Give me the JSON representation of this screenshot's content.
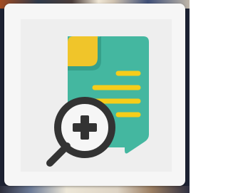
{
  "icon": {
    "name": "document-zoom-in-icon",
    "parts": [
      "document-icon",
      "text-lines-icon",
      "magnifying-glass-icon",
      "plus-icon"
    ]
  },
  "colors": {
    "card": "#f6f6f6",
    "panel": "#eeeeee",
    "document": "#44b7a0",
    "document_shadow": "#36a08a",
    "corner": "#f0c52a",
    "lines": "#f6cd1a",
    "magnifier": "#333333"
  }
}
